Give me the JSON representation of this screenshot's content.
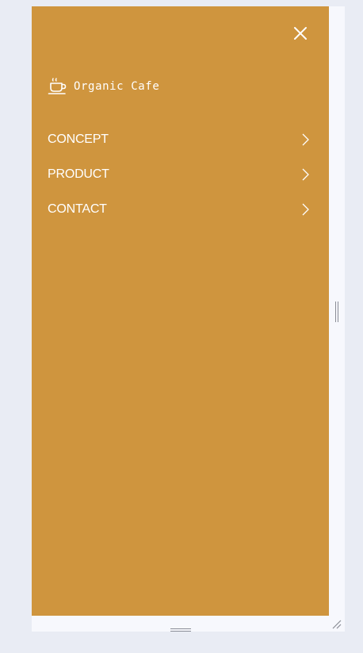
{
  "menu": {
    "logo_text": "Organic Cafe",
    "logo_icon": "coffee-cup-icon",
    "close_icon": "close-icon",
    "items": [
      {
        "label": "CONCEPT",
        "icon": "chevron-right-icon"
      },
      {
        "label": "PRODUCT",
        "icon": "chevron-right-icon"
      },
      {
        "label": "CONTACT",
        "icon": "chevron-right-icon"
      }
    ]
  },
  "colors": {
    "panel_background": "#cf953e",
    "page_background": "#e9ecf4",
    "frame_background": "#f7f8fd",
    "text": "#ffffff"
  }
}
